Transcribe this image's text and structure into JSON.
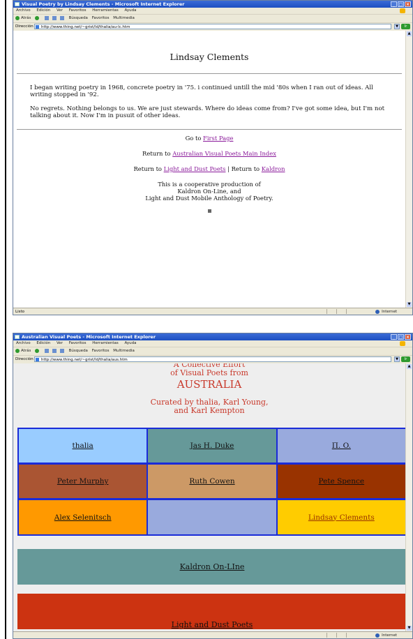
{
  "windows": [
    {
      "title": "Visual Poetry by Lindsay Clements - Microsoft Internet Explorer",
      "menu": [
        "Archivo",
        "Edición",
        "Ver",
        "Favoritos",
        "Herramientas",
        "Ayuda"
      ],
      "toolbar": {
        "back": "Atrás",
        "search": "Búsqueda",
        "favorites": "Favoritos",
        "media": "Multimedia"
      },
      "address_label": "Dirección",
      "address": "http://www.thing.net/~grist/ld/thalia/au-lc.htm",
      "go_label": "Ir",
      "status": "Listo",
      "zone": "Internet"
    },
    {
      "title": "Australian Visual Poets - Microsoft Internet Explorer",
      "menu": [
        "Archivo",
        "Edición",
        "Ver",
        "Favoritos",
        "Herramientas",
        "Ayuda"
      ],
      "toolbar": {
        "back": "Atrás",
        "search": "Búsqueda",
        "favorites": "Favoritos",
        "media": "Multimedia"
      },
      "address_label": "Dirección",
      "address": "http://www.thing.net/~grist/ld/thalia/aus.htm",
      "go_label": "Ir",
      "status": "",
      "zone": "Internet"
    }
  ],
  "page1": {
    "heading": "Lindsay Clements",
    "para1": "I began writing poetry in 1968, concrete poetry in '75. i continued untill the mid '80s when I ran out of ideas. All writing stopped in '92.",
    "para2": "No regrets. Nothing belongs to us. We are just stewards. Where do ideas come from? I've got some idea, but I'm not talking about it. Now I'm in pusuit of other ideas.",
    "goto_prefix": "Go to ",
    "goto_link": "First Page",
    "return_prefix": "Return to ",
    "return_link": "Australian Visual Poets Main Index",
    "return2_prefix": "Return to ",
    "return2_link": "Light and Dust Poets",
    "return2_sep": " | Return to ",
    "return2_link2": "Kaldron",
    "coop_line1": "This is a cooperative production of",
    "coop_line2": "Kaldron On-Line, and",
    "coop_line3": "Light and Dust Mobile Anthology of Poetry."
  },
  "page2": {
    "line1": "A Collective Effort",
    "line2": "of Visual Poets from",
    "line3": "AUSTRALIA",
    "line4": "Curated by thalia, Karl Young,",
    "line5": "and Karl Kempton",
    "grid": [
      [
        {
          "label": "thalia",
          "bg": "#99ccff"
        },
        {
          "label": "Jas H. Duke",
          "bg": "#669999"
        },
        {
          "label": "Π. O.",
          "bg": "#99aadd"
        }
      ],
      [
        {
          "label": "Peter Murphy",
          "bg": "#aa5533"
        },
        {
          "label": "Ruth Cowen",
          "bg": "#cc9966"
        },
        {
          "label": "Pete Spence",
          "bg": "#993300"
        }
      ],
      [
        {
          "label": "Alex Selenitsch",
          "bg": "#ff9900"
        },
        {
          "label": "",
          "bg": "#99aadd"
        },
        {
          "label": "Lindsay Clements",
          "bg": "#ffcc00",
          "color": "#993300"
        }
      ]
    ],
    "band1": "Kaldron On-LIne",
    "band1_bg": "#669999",
    "band2": "Light and Dust Poets",
    "band2_bg": "#cc3311"
  }
}
